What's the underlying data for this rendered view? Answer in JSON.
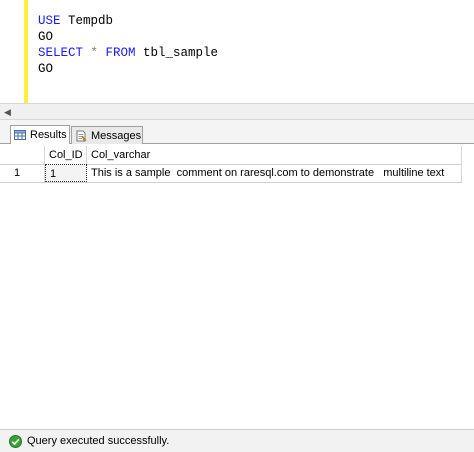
{
  "editor": {
    "lines": [
      {
        "keyword": "USE",
        "rest": " Tempdb"
      },
      {
        "keyword": "",
        "rest": "GO"
      },
      {
        "keyword": "SELECT",
        "op": " * ",
        "keyword2": "FROM",
        "rest": " tbl_sample"
      },
      {
        "keyword": "",
        "rest": "GO"
      }
    ]
  },
  "tabs": {
    "results_label": "Results",
    "messages_label": "Messages",
    "results_icon": "grid-icon",
    "messages_icon": "messages-icon"
  },
  "grid": {
    "columns": [
      "Col_ID",
      "Col_varchar"
    ],
    "rows": [
      {
        "rownum": "1",
        "col_id": "1",
        "col_varchar": "This is a sample  comment on raresql.com to demonstrate   multiline text"
      }
    ]
  },
  "status": {
    "text": "Query executed successfully.",
    "icon": "success-check-icon",
    "color": "#3aa13a"
  },
  "colors": {
    "keyword": "#1a1aff",
    "change_bar": "#ffef3a"
  }
}
